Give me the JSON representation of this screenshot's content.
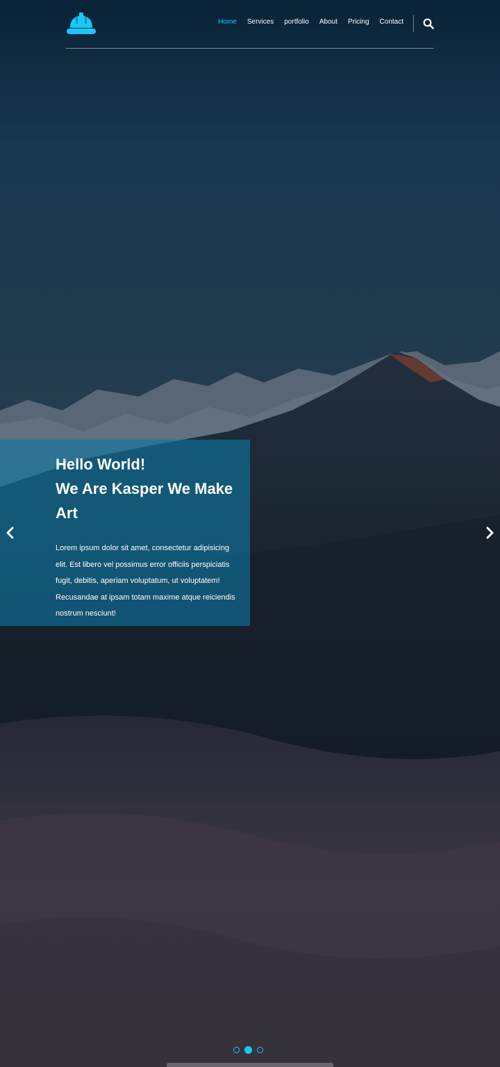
{
  "brand": {
    "logo_icon": "hard-hat-icon",
    "color": "#19c8fa"
  },
  "nav": {
    "items": [
      {
        "label": "Home",
        "active": true
      },
      {
        "label": "Services",
        "active": false
      },
      {
        "label": "portfolio",
        "active": false
      },
      {
        "label": "About",
        "active": false
      },
      {
        "label": "Pricing",
        "active": false
      },
      {
        "label": "Contact",
        "active": false
      }
    ],
    "search_icon": "search-icon",
    "active_color": "#19c8fa"
  },
  "slider": {
    "heading_line1": "Hello World!",
    "heading_line2": "We Are Kasper We Make Art",
    "body": "Lorem ipsum dolor sit amet, consectetur adipisicing elit. Est libero vel possimus error officiis perspiciatis fugit, debitis, aperiam voluptatum, ut voluptatem! Recusandae at ipsam totam maxime atque reiciendis nostrum nesciunt!",
    "prev_icon": "chevron-left-icon",
    "next_icon": "chevron-right-icon",
    "slide_count": 3,
    "active_slide": 2
  }
}
